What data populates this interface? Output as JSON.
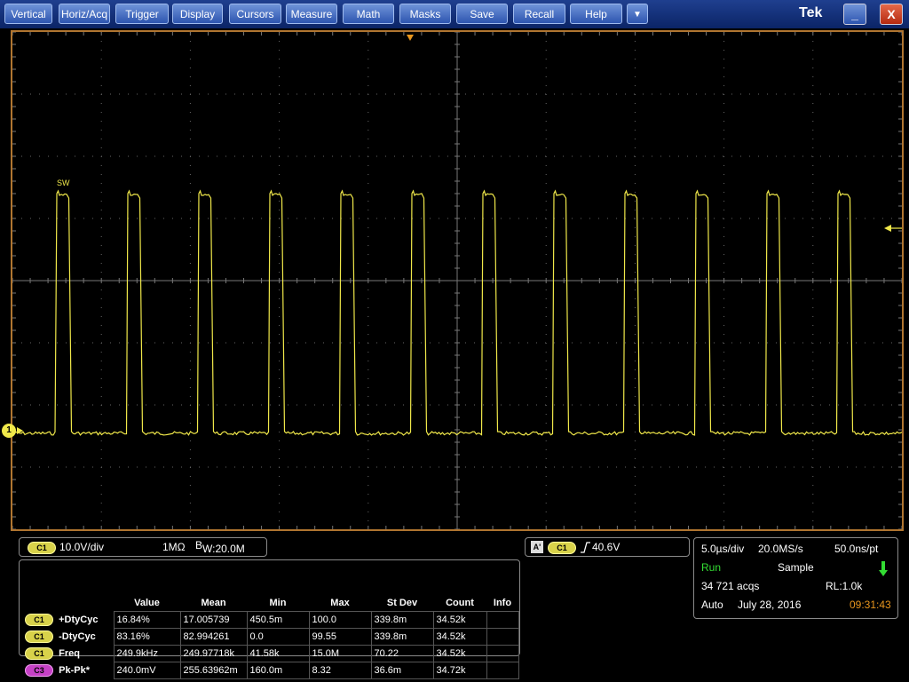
{
  "menu": {
    "items": [
      "Vertical",
      "Horiz/Acq",
      "Trigger",
      "Display",
      "Cursors",
      "Measure",
      "Math",
      "Masks",
      "Save",
      "Recall",
      "Help"
    ],
    "more_icon": "▼",
    "brand": "Tek",
    "minimize_icon": "_",
    "close_icon": "X"
  },
  "waveform": {
    "label": "SW",
    "channel_marker": "1",
    "color": "#f0e84a",
    "pulse_count": 12,
    "duty_cycle_percent": 16.84
  },
  "channel_box": {
    "badge": "C1",
    "scale": "10.0V/div",
    "impedance": "1MΩ",
    "bw_prefix": "B",
    "bw_suffix": "W:20.0M"
  },
  "trigger_box": {
    "mode_letter": "A'",
    "badge": "C1",
    "level": "40.6V"
  },
  "timebase": {
    "time_div": "5.0µs/div",
    "sample_rate": "20.0MS/s",
    "resolution": "50.0ns/pt",
    "state": "Run",
    "acq_mode": "Sample",
    "acqs": "34 721 acqs",
    "record_length": "RL:1.0k",
    "trigger_mode": "Auto",
    "date": "July 28, 2016",
    "time": "09:31:43"
  },
  "measurements": {
    "headers": [
      "Value",
      "Mean",
      "Min",
      "Max",
      "St Dev",
      "Count",
      "Info"
    ],
    "rows": [
      {
        "badge": "C1",
        "name": "+DtyCyc",
        "value": "16.84%",
        "mean": "17.005739",
        "min": "450.5m",
        "max": "100.0",
        "stdev": "339.8m",
        "count": "34.52k",
        "info": ""
      },
      {
        "badge": "C1",
        "name": "-DtyCyc",
        "value": "83.16%",
        "mean": "82.994261",
        "min": "0.0",
        "max": "99.55",
        "stdev": "339.8m",
        "count": "34.52k",
        "info": ""
      },
      {
        "badge": "C1",
        "name": "Freq",
        "value": "249.9kHz",
        "mean": "249.97718k",
        "min": "41.58k",
        "max": "15.0M",
        "stdev": "70.22",
        "count": "34.52k",
        "info": ""
      },
      {
        "badge": "C3",
        "name": "Pk-Pk*",
        "value": "240.0mV",
        "mean": "255.63962m",
        "min": "160.0m",
        "max": "8.32",
        "stdev": "36.6m",
        "count": "34.72k",
        "info": ""
      }
    ]
  }
}
